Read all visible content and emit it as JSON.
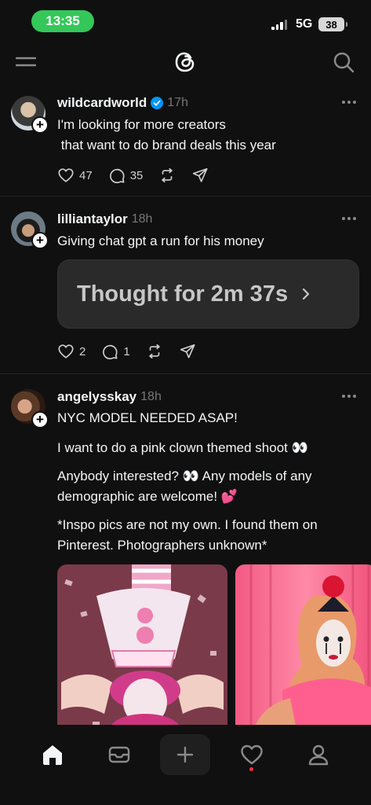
{
  "status_bar": {
    "time": "13:35",
    "network": "5G",
    "battery": "38"
  },
  "header": {
    "logo_icon": "threads-logo",
    "menu_icon": "menu-icon",
    "search_icon": "search-icon"
  },
  "posts": [
    {
      "username": "wildcardworld",
      "verified": true,
      "time": "17h",
      "text": "I'm looking for more creators\n that want to do brand deals this year",
      "likes": "47",
      "comments": "35"
    },
    {
      "username": "lilliantaylor",
      "verified": false,
      "time": "18h",
      "text": "Giving chat gpt a run for his money",
      "card_text": "Thought for 2m 37s",
      "likes": "2",
      "comments": "1"
    },
    {
      "username": "angelysskay",
      "verified": false,
      "time": "18h",
      "text_1": "NYC MODEL NEEDED ASAP!",
      "text_2": "I want to do a pink clown themed shoot 👀",
      "text_3": "Anybody interested? 👀 Any models of any demographic are welcome! 💕",
      "text_4": "*Inspo pics are not my own. I found them on Pinterest. Photographers unknown*"
    }
  ],
  "colors": {
    "background": "#101010",
    "accent_green": "#34c759",
    "verified_blue": "#0095f6",
    "notification_red": "#ff3040"
  },
  "bottom_nav": {
    "items": [
      "home-icon",
      "mail-icon",
      "compose-icon",
      "heart-icon",
      "profile-icon"
    ]
  }
}
